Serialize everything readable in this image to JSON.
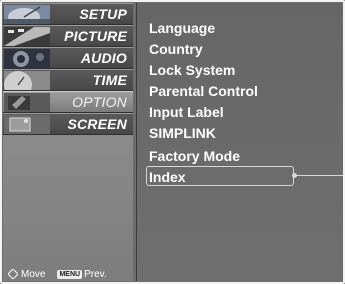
{
  "sidebar": {
    "items": [
      {
        "label": "SETUP",
        "icon": "satellite-dish-icon",
        "selected": false
      },
      {
        "label": "PICTURE",
        "icon": "film-strip-icon",
        "selected": false
      },
      {
        "label": "AUDIO",
        "icon": "speaker-icon",
        "selected": false
      },
      {
        "label": "TIME",
        "icon": "clock-icon",
        "selected": false
      },
      {
        "label": "OPTION",
        "icon": "special-tag-icon",
        "selected": true
      },
      {
        "label": "SCREEN",
        "icon": "screen-icon",
        "selected": false
      }
    ]
  },
  "submenu": {
    "items": [
      "Language",
      "Country",
      "Lock System",
      "Parental Control",
      "Input Label",
      "SIMPLINK",
      "Factory Mode",
      "Index"
    ],
    "highlighted": "Index"
  },
  "hint": {
    "move_label": "Move",
    "menu_key": "MENU",
    "prev_label": "Prev."
  },
  "colors": {
    "panel_bg": "#6d6d6d",
    "menu_item_bg": "#505050",
    "selected_item_bg": "#8e8e8e",
    "text": "#ffffff",
    "highlight_border": "#d8d8d8"
  }
}
